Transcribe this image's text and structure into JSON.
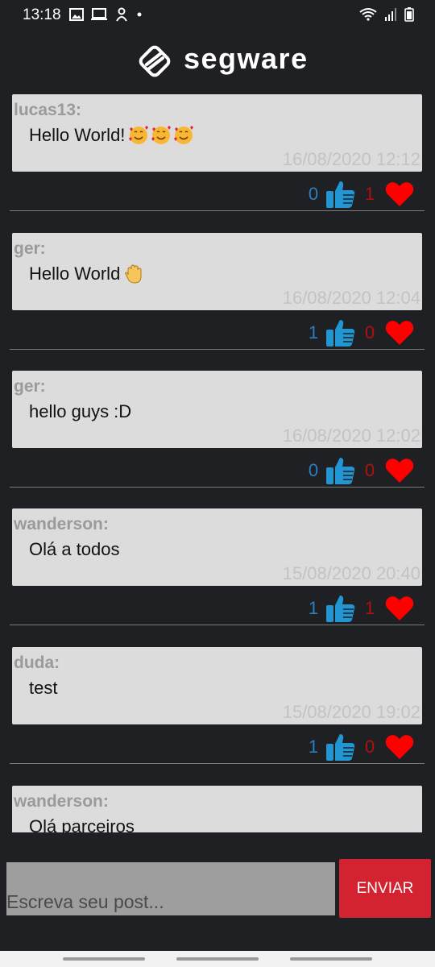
{
  "status_bar": {
    "time": "13:18",
    "left_icons": [
      "image-icon",
      "laptop-icon",
      "user-icon",
      "dot-icon"
    ],
    "right_icons": [
      "wifi-icon",
      "signal-icon",
      "battery-icon"
    ]
  },
  "header": {
    "brand": "segware",
    "logo_icon": "segware-logo-icon"
  },
  "colors": {
    "background": "#1e2023",
    "card": "#dcdcdc",
    "like": "#2196d3",
    "love": "#ff0000",
    "send": "#d32230"
  },
  "posts": [
    {
      "author": "lucas13:",
      "message": "Hello World!",
      "emoji": "smiling-face-with-hearts",
      "emoji_count": 3,
      "timestamp": "16/08/2020 12:12",
      "likes": "0",
      "loves": "1"
    },
    {
      "author": "ger:",
      "message": "Hello World",
      "emoji": "waving-hand",
      "emoji_count": 1,
      "timestamp": "16/08/2020 12:04",
      "likes": "1",
      "loves": "0"
    },
    {
      "author": "ger:",
      "message": "hello guys :D",
      "emoji": "",
      "emoji_count": 0,
      "timestamp": "16/08/2020 12:02",
      "likes": "0",
      "loves": "0"
    },
    {
      "author": "wanderson:",
      "message": "Olá a todos",
      "emoji": "",
      "emoji_count": 0,
      "timestamp": "15/08/2020 20:40",
      "likes": "1",
      "loves": "1"
    },
    {
      "author": "duda:",
      "message": "test",
      "emoji": "",
      "emoji_count": 0,
      "timestamp": "15/08/2020 19:02",
      "likes": "1",
      "loves": "0"
    },
    {
      "author": "wanderson:",
      "message": "Olá parceiros",
      "emoji": "",
      "emoji_count": 0,
      "timestamp": "",
      "likes": "",
      "loves": ""
    }
  ],
  "composer": {
    "placeholder": "Escreva seu post...",
    "value": "",
    "send_label": "ENVIAR"
  }
}
